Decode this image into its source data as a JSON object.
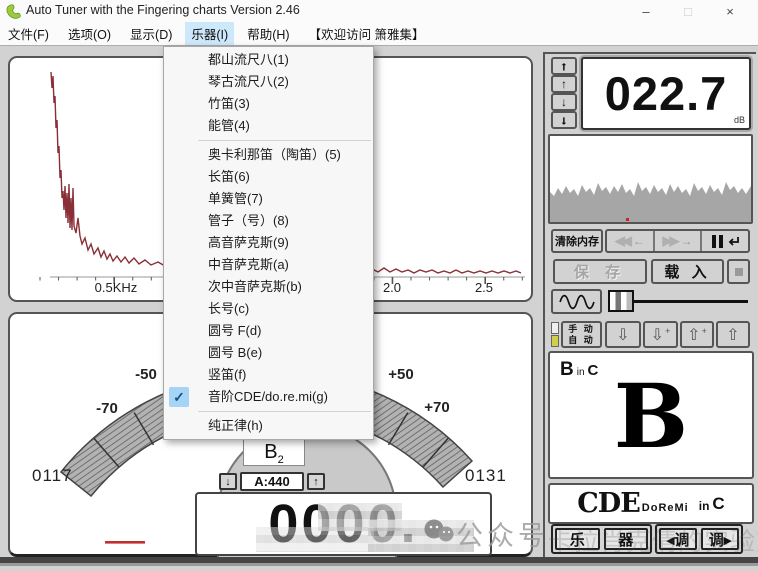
{
  "window": {
    "title": "Auto Tuner with the Fingering charts  Version 2.46",
    "minimize": "–",
    "maximize": "□",
    "close": "×"
  },
  "menubar": {
    "items": [
      {
        "label": "文件(F)"
      },
      {
        "label": "选项(O)"
      },
      {
        "label": "显示(D)"
      },
      {
        "label": "乐器(I)",
        "active": true
      },
      {
        "label": "帮助(H)"
      },
      {
        "label": "【欢迎访问 箫雅集】"
      }
    ]
  },
  "instrument_menu": {
    "check_glyph": "✓",
    "items": [
      {
        "label": "都山流尺八(1)"
      },
      {
        "label": "琴古流尺八(2)"
      },
      {
        "label": "竹笛(3)"
      },
      {
        "label": "能管(4)",
        "separator_after": true
      },
      {
        "label": "奥卡利那笛（陶笛）(5)"
      },
      {
        "label": "长笛(6)"
      },
      {
        "label": "单簧管(7)"
      },
      {
        "label": "管子（号）(8)"
      },
      {
        "label": "高音萨克斯(9)"
      },
      {
        "label": "中音萨克斯(a)"
      },
      {
        "label": "次中音萨克斯(b)"
      },
      {
        "label": "长号(c)"
      },
      {
        "label": "圆号 F(d)"
      },
      {
        "label": "圆号 B(e)"
      },
      {
        "label": "竖笛(f)"
      },
      {
        "label": "音阶CDE/do.re.mi(g)",
        "checked": true,
        "separator_after": true
      },
      {
        "label": "纯正律(h)"
      }
    ]
  },
  "spectrum": {
    "x_ticks": [
      "0.5KHz",
      "2.0",
      "2.5"
    ]
  },
  "level_display": {
    "value": "022.7",
    "unit": "dB"
  },
  "gain_stepper": {
    "up_coarse": "↑",
    "up_fine": "↑",
    "down_fine": "↓",
    "down_coarse": "↓"
  },
  "transport": {
    "clear": "清除内存",
    "rewind_icon": "◀◀",
    "rewind_arrow": "←",
    "forward_icon": "▶▶",
    "forward_arrow": "→"
  },
  "file_controls": {
    "save": "保 存",
    "load": "载 入"
  },
  "mode_controls": {
    "manual": "手 动",
    "auto": "自 动"
  },
  "pitch_stepper": {
    "down": "⇩",
    "down_fine": "⇩",
    "up_fine": "⇧",
    "up": "⇧",
    "fine_mark": "+"
  },
  "note_display": {
    "note": "B",
    "in_label": "in",
    "key": "C",
    "big_note": "B"
  },
  "scale_display": {
    "cde": "CDE",
    "doremi": "DoReMi",
    "in_label": "in",
    "key": "C"
  },
  "bottom_controls": {
    "instrument_left": "乐",
    "instrument_right": "器",
    "key_left": "◂调",
    "key_right": "调▸"
  },
  "meter": {
    "minus50": "-50",
    "minus70": "-70",
    "plus50": "+50",
    "plus70": "+70",
    "left_counter": "0117",
    "right_counter": "0131",
    "note": "B",
    "octave": "2",
    "spin_down": "↓",
    "spin_up": "↑",
    "reference": "A:440",
    "counter": "0000."
  },
  "watermark": {
    "label": "公众号",
    "faint_text": "卡拉肖克倩的实验室"
  },
  "colors": {
    "menu_highlight": "#cde8fb",
    "spectrum_line": "#8a2f38",
    "noise_fill": "#a6a6a6",
    "indicator_yellow": "#cfcf4a",
    "needle_red": "#c03030"
  }
}
